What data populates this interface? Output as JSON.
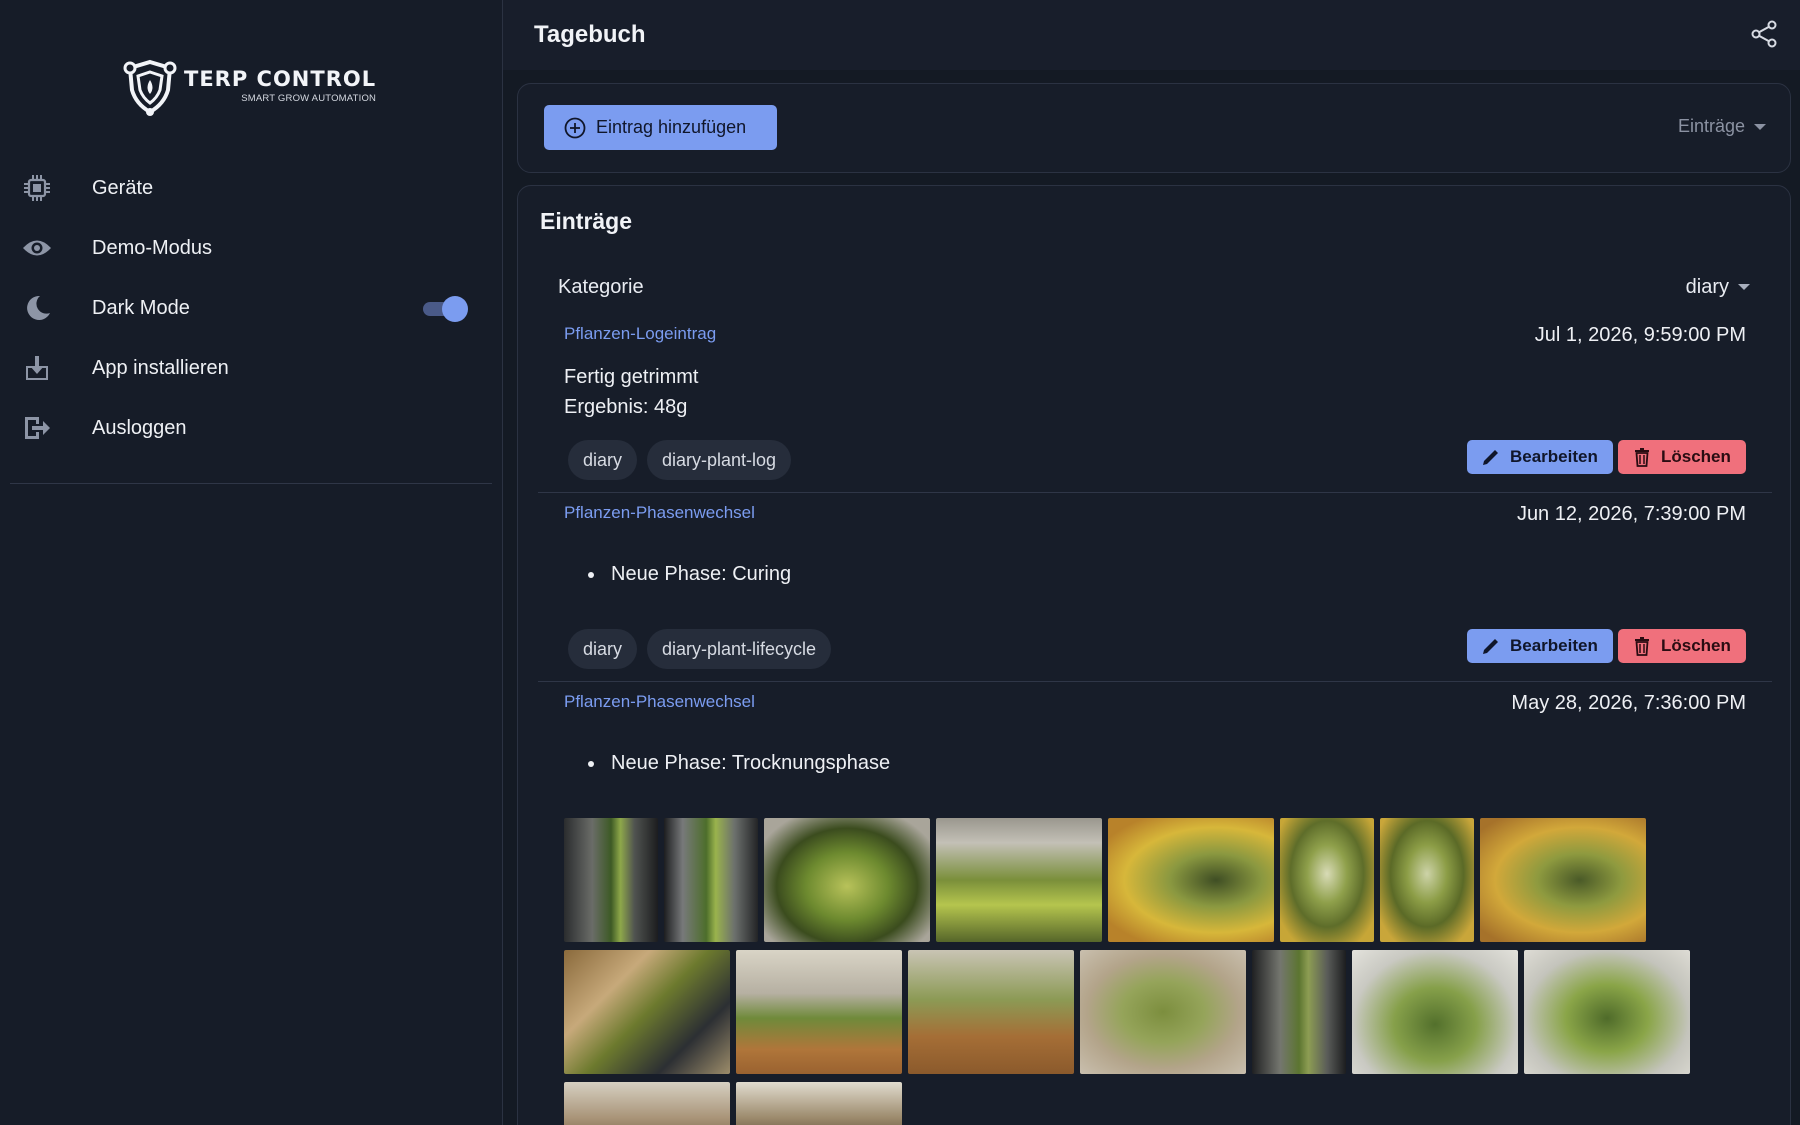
{
  "brand": {
    "title": "TERP CONTROL",
    "subtitle": "SMART GROW AUTOMATION"
  },
  "sidebar": {
    "items": [
      {
        "label": "Geräte",
        "icon": "chip-icon"
      },
      {
        "label": "Demo-Modus",
        "icon": "eye-icon"
      },
      {
        "label": "Dark Mode",
        "icon": "moon-icon",
        "toggle": true
      },
      {
        "label": "App installieren",
        "icon": "download-icon"
      },
      {
        "label": "Ausloggen",
        "icon": "logout-icon"
      }
    ]
  },
  "header": {
    "title": "Tagebuch"
  },
  "actions_card": {
    "add_label": "Eintrag hinzufügen",
    "select_label": "Einträge"
  },
  "entries_card": {
    "title": "Einträge",
    "category_label": "Kategorie",
    "category_value": "diary",
    "edit_label": "Bearbeiten",
    "delete_label": "Löschen",
    "entries": [
      {
        "type": "Pflanzen-Logeintrag",
        "date": "Jul 1, 2026, 9:59:00 PM",
        "lines": [
          "Fertig getrimmt",
          "Ergebnis: 48g"
        ],
        "tags": [
          "diary",
          "diary-plant-log"
        ]
      },
      {
        "type": "Pflanzen-Phasenwechsel",
        "date": "Jun 12, 2026, 7:39:00 PM",
        "bullet": "Neue Phase: Curing",
        "tags": [
          "diary",
          "diary-plant-lifecycle"
        ]
      },
      {
        "type": "Pflanzen-Phasenwechsel",
        "date": "May 28, 2026, 7:36:00 PM",
        "bullet": "Neue Phase: Trocknungsphase"
      }
    ]
  },
  "colors": {
    "accent": "#7b9cf0",
    "danger": "#f0707c",
    "background": "#141a24",
    "card": "#171d29"
  }
}
